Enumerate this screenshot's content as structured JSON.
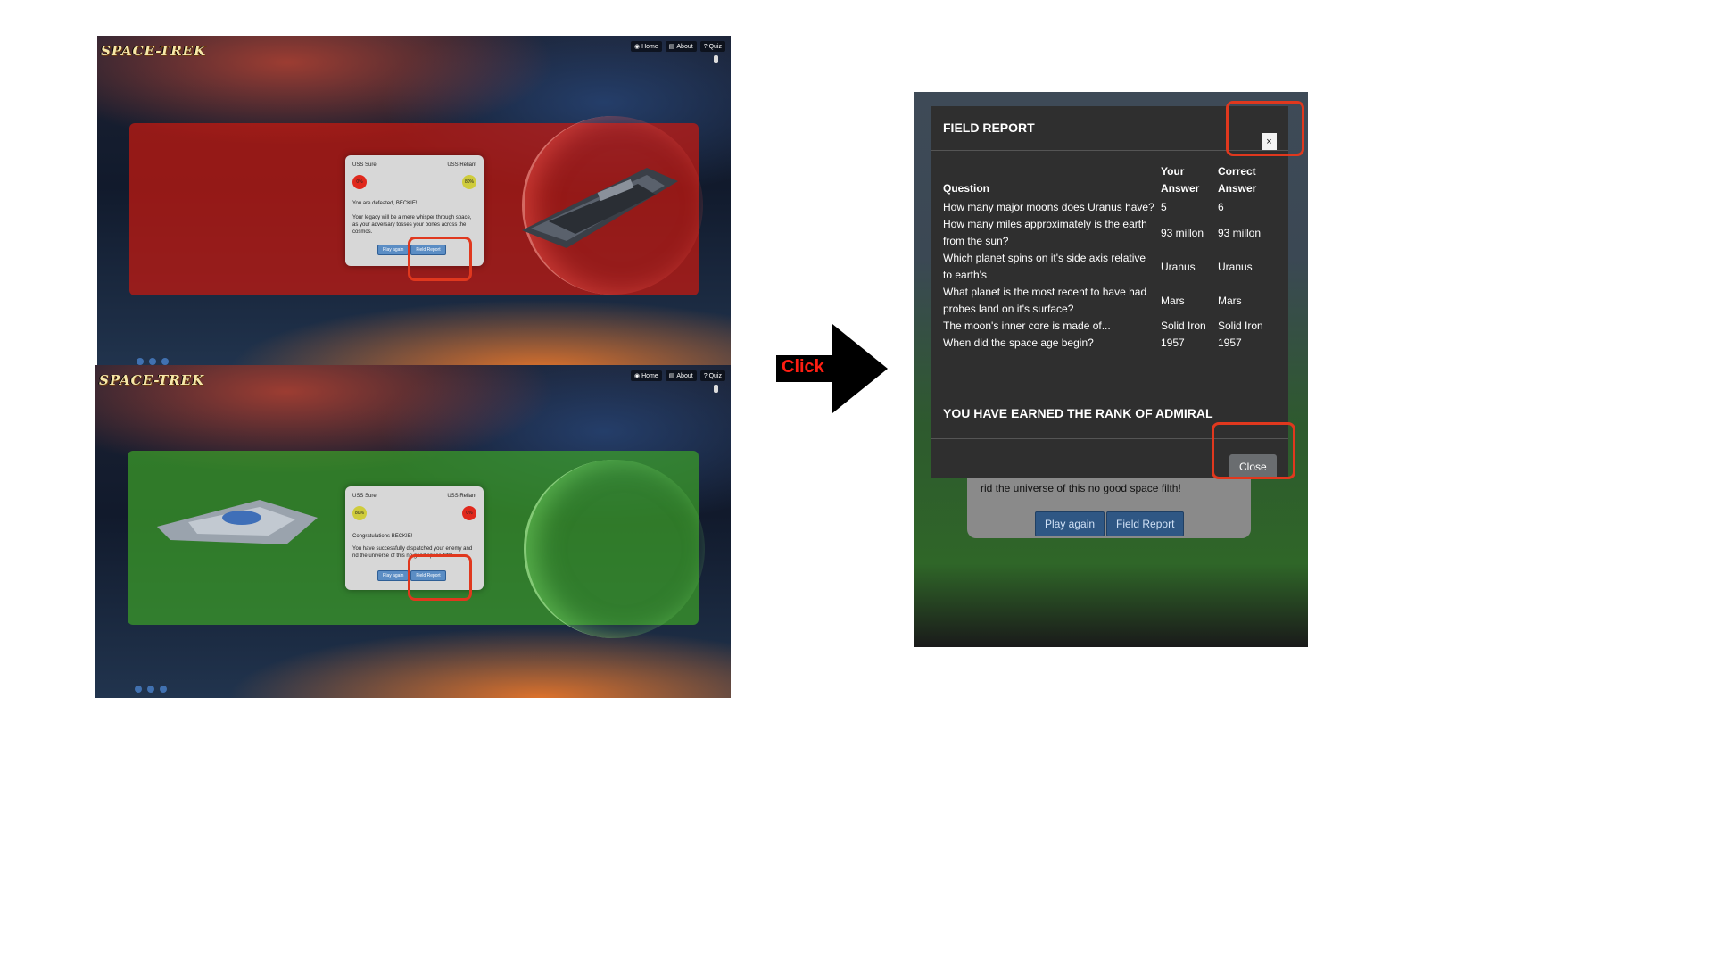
{
  "arrow": {
    "label": "Click"
  },
  "game": {
    "logo": "SPACE-TREK",
    "nav": [
      {
        "glyph": "◉",
        "label": "Home"
      },
      {
        "glyph": "▤",
        "label": "About"
      },
      {
        "glyph": "?",
        "label": "Quiz"
      }
    ]
  },
  "defeat": {
    "player": "USS Sure",
    "enemy": "USS Reliant",
    "player_score": "0%",
    "enemy_score": "80%",
    "line1": "You are defeated, BECKIE!",
    "line2": "Your legacy will be a mere whisper through space, as your adversary tosses your bones across the cosmos.",
    "play_again": "Play again",
    "field_report": "Field Report"
  },
  "victory": {
    "player": "USS Sure",
    "enemy": "USS Reliant",
    "player_score": "80%",
    "enemy_score": "0%",
    "line1": "Congratulations BECKIE!",
    "line2": "You have successfully dispatched your enemy and rid the universe of this no good space filth!",
    "play_again": "Play again",
    "field_report": "Field Report"
  },
  "modal": {
    "title": "FIELD REPORT",
    "close_x": "×",
    "headers": {
      "question": "Question",
      "your": "Your Answer",
      "correct": "Correct Answer"
    },
    "rows": [
      {
        "q": "How many major moons does Uranus have?",
        "y": "5",
        "c": "6"
      },
      {
        "q": "How many miles approximately is the earth from the sun?",
        "y": "93 millon",
        "c": "93 millon"
      },
      {
        "q": "Which planet spins on it's side axis relative to earth's",
        "y": "Uranus",
        "c": "Uranus"
      },
      {
        "q": "What planet is the most recent to have had probes land on it's surface?",
        "y": "Mars",
        "c": "Mars"
      },
      {
        "q": "The moon's inner core is made of...",
        "y": "Solid Iron",
        "c": "Solid Iron"
      },
      {
        "q": "When did the space age begin?",
        "y": "1957",
        "c": "1957"
      }
    ],
    "rank": "YOU HAVE EARNED THE RANK OF ADMIRAL",
    "close_button": "Close",
    "behind_text": "rid the universe of this no good space filth!",
    "behind_play_again": "Play again",
    "behind_field_report": "Field Report"
  },
  "colors": {
    "highlight": "#e0381e",
    "defeat_stage": "#c8190f",
    "victory_stage": "#3ca028",
    "modal_bg": "#2f2f2f"
  }
}
